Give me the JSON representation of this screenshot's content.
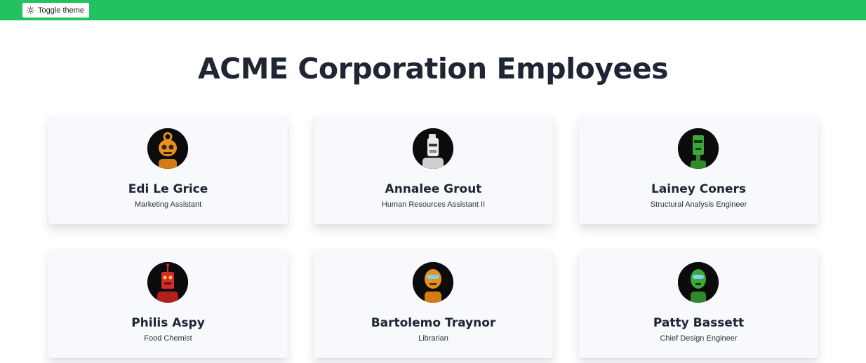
{
  "toolbar": {
    "toggle_label": "Toggle theme",
    "toggle_icon": "sun-icon",
    "bar_color": "#22c35e"
  },
  "page": {
    "title": "ACME Corporation Employees"
  },
  "employees": [
    {
      "name": "Edi Le Grice",
      "title": "Marketing Assistant",
      "avatar_icon": "robot-avatar-icon",
      "avatar_color": "#e8901f"
    },
    {
      "name": "Annalee Grout",
      "title": "Human Resources Assistant II",
      "avatar_icon": "robot-avatar-icon",
      "avatar_color": "#d9d9d9"
    },
    {
      "name": "Lainey Coners",
      "title": "Structural Analysis Engineer",
      "avatar_icon": "robot-avatar-icon",
      "avatar_color": "#3fa63a"
    },
    {
      "name": "Philis Aspy",
      "title": "Food Chemist",
      "avatar_icon": "robot-avatar-icon",
      "avatar_color": "#d42b2b"
    },
    {
      "name": "Bartolemo Traynor",
      "title": "Librarian",
      "avatar_icon": "robot-avatar-icon",
      "avatar_color": "#e8901f"
    },
    {
      "name": "Patty Bassett",
      "title": "Chief Design Engineer",
      "avatar_icon": "robot-avatar-icon",
      "avatar_color": "#3fa63a"
    }
  ]
}
